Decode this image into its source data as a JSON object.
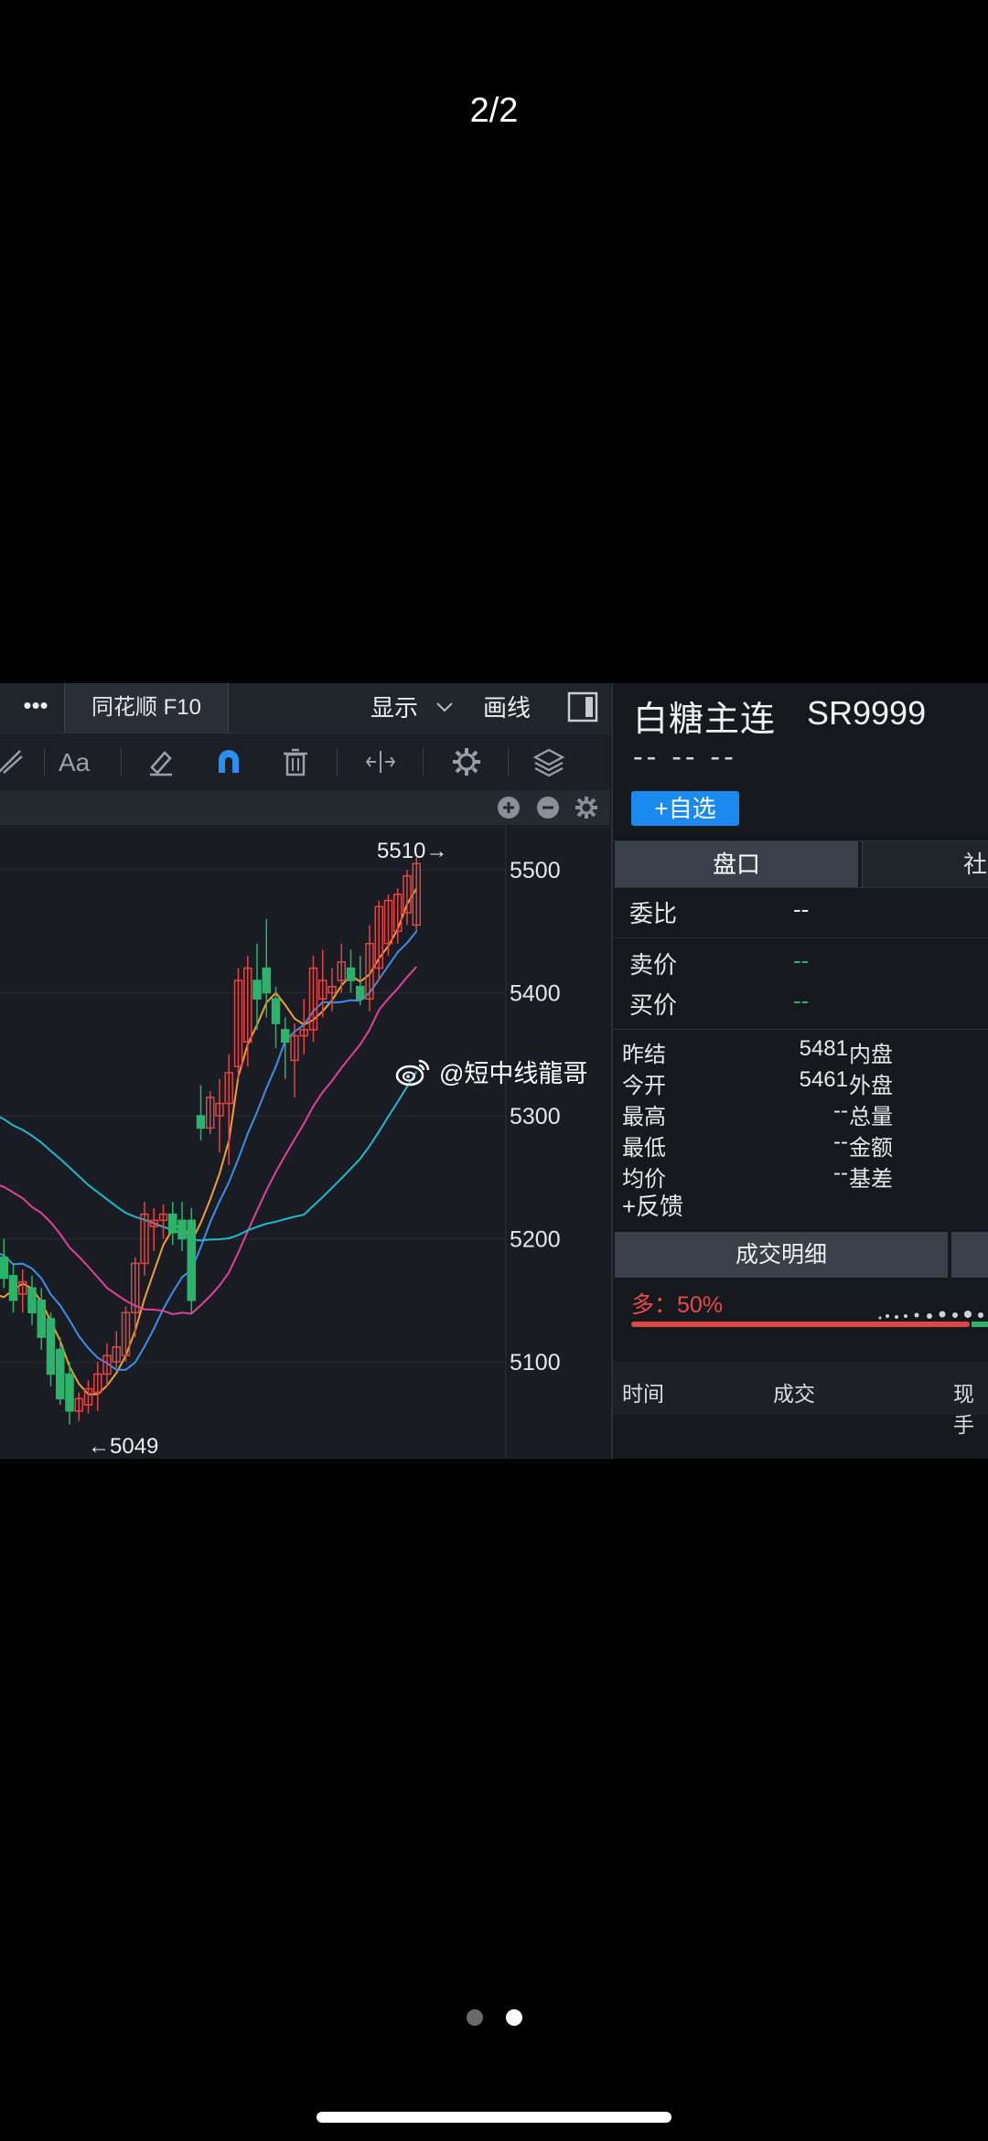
{
  "page": {
    "counter": "2/2",
    "watermark": "@短中线龍哥"
  },
  "chart_toolbar": {
    "more_label": "•••",
    "f10_label": "同花顺 F10",
    "show_label": "显示",
    "draw_label": "画线",
    "aa_label": "Aa",
    "tools": [
      "ruler-icon",
      "text-size-icon",
      "eraser-icon",
      "magnet-icon",
      "trash-icon",
      "resize-icon",
      "settings-icon",
      "layers-icon"
    ]
  },
  "quote": {
    "name": "白糖主连",
    "code": "SR9999",
    "price_dashes": "-- -- --",
    "add_watch": "+自选",
    "tab_order_book": "盘口",
    "tab_other": "社",
    "order_ratio": {
      "label": "委比",
      "value": "--"
    },
    "ask": {
      "label": "卖价",
      "value": "--"
    },
    "bid": {
      "label": "买价",
      "value": "--"
    },
    "stats": [
      {
        "k": "昨结",
        "v": "5481",
        "k2": "内盘",
        "green": false
      },
      {
        "k": "今开",
        "v": "5461",
        "k2": "外盘",
        "green": true
      },
      {
        "k": "最高",
        "v": "--",
        "k2": "总量",
        "green": false
      },
      {
        "k": "最低",
        "v": "--",
        "k2": "金额",
        "green": false
      },
      {
        "k": "均价",
        "v": "--",
        "k2": "基差",
        "green": false
      }
    ],
    "feedback": "+反馈",
    "deal_detail": "成交明细",
    "long_ratio": "多：50%",
    "table_headers": [
      "时间",
      "成交",
      "现手"
    ],
    "colors": {
      "up": "#e04545",
      "down": "#2bb36a",
      "accent": "#1b8af0"
    }
  },
  "chart_data": {
    "type": "candlestick",
    "y_ticks": [
      "5500",
      "5400",
      "5300",
      "5200",
      "5100"
    ],
    "ylim": [
      5040,
      5520
    ],
    "annotations": {
      "high_label": "5510→",
      "low_label": "←5049"
    },
    "candles": [
      [
        5175,
        5195,
        5165,
        5175
      ],
      [
        5185,
        5200,
        5160,
        5168
      ],
      [
        5170,
        5180,
        5140,
        5150
      ],
      [
        5155,
        5175,
        5140,
        5165
      ],
      [
        5160,
        5170,
        5130,
        5140
      ],
      [
        5150,
        5160,
        5110,
        5120
      ],
      [
        5135,
        5140,
        5080,
        5090
      ],
      [
        5110,
        5120,
        5065,
        5070
      ],
      [
        5090,
        5100,
        5049,
        5060
      ],
      [
        5060,
        5075,
        5052,
        5070
      ],
      [
        5065,
        5085,
        5058,
        5078
      ],
      [
        5075,
        5100,
        5060,
        5090
      ],
      [
        5090,
        5115,
        5080,
        5105
      ],
      [
        5100,
        5125,
        5095,
        5112
      ],
      [
        5105,
        5145,
        5100,
        5140
      ],
      [
        5140,
        5185,
        5120,
        5180
      ],
      [
        5180,
        5230,
        5170,
        5220
      ],
      [
        5210,
        5225,
        5190,
        5215
      ],
      [
        5215,
        5228,
        5200,
        5220
      ],
      [
        5220,
        5230,
        5195,
        5205
      ],
      [
        5215,
        5230,
        5190,
        5200
      ],
      [
        5215,
        5225,
        5140,
        5150
      ],
      [
        5300,
        5325,
        5280,
        5290
      ],
      [
        5290,
        5320,
        5285,
        5315
      ],
      [
        5300,
        5330,
        5270,
        5310
      ],
      [
        5310,
        5350,
        5260,
        5335
      ],
      [
        5340,
        5420,
        5330,
        5410
      ],
      [
        5360,
        5430,
        5340,
        5420
      ],
      [
        5410,
        5440,
        5370,
        5395
      ],
      [
        5420,
        5460,
        5380,
        5400
      ],
      [
        5395,
        5405,
        5355,
        5375
      ],
      [
        5370,
        5380,
        5330,
        5360
      ],
      [
        5345,
        5375,
        5315,
        5365
      ],
      [
        5365,
        5395,
        5350,
        5370
      ],
      [
        5370,
        5430,
        5360,
        5420
      ],
      [
        5395,
        5435,
        5380,
        5410
      ],
      [
        5400,
        5420,
        5385,
        5405
      ],
      [
        5410,
        5440,
        5400,
        5425
      ],
      [
        5420,
        5435,
        5400,
        5410
      ],
      [
        5405,
        5430,
        5390,
        5395
      ],
      [
        5395,
        5455,
        5385,
        5440
      ],
      [
        5420,
        5475,
        5410,
        5470
      ],
      [
        5440,
        5480,
        5430,
        5475
      ],
      [
        5450,
        5485,
        5440,
        5480
      ],
      [
        5465,
        5500,
        5455,
        5495
      ],
      [
        5455,
        5510,
        5450,
        5505
      ]
    ],
    "ma_colors": [
      "#f0a030",
      "#3c8ee8",
      "#e0409a",
      "#1fb8cc"
    ]
  }
}
